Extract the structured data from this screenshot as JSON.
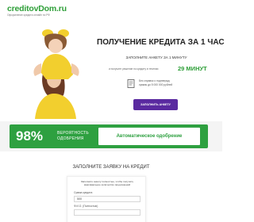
{
  "header": {
    "logo": "creditovDom.ru",
    "tagline": "Оформление кредита онлайн по РФ"
  },
  "hero": {
    "title": "ПОЛУЧЕНИЕ КРЕДИТА ЗА 1 ЧАС",
    "form_label": "ЗАПОЛНИТЕ АНКЕТУ ЗА 1 МИНУТУ",
    "decision_text": "и получите решение по кредиту в течении",
    "decision_time": "29 МИНУТ",
    "docs_line1": "Без справок о подтвержд",
    "docs_line2": "суммы до 5 000 000 рублей",
    "cta_label": "ЗАПОЛНИТЬ АНКЕТУ"
  },
  "approval": {
    "percent": "98%",
    "label_line1": "ВЕРОЯТНОСТЬ",
    "label_line2": "ОДОБРЕНИЯ",
    "auto_text": "Автоматическое одобрение"
  },
  "application": {
    "title": "ЗАПОЛНИТЕ ЗАЯВКУ НА КРЕДИТ",
    "intro_line1": "Заполните анкету полностью, чтобы получить",
    "intro_line2": "максимальное количество предложений",
    "amount_label": "Сумма кредита",
    "amount_value": "500",
    "fullname_label": "Ф.И.О. (Полностью)"
  },
  "colors": {
    "brand_green": "#2ea040",
    "cta_purple": "#5a2aa0",
    "model_dress": "#f2cf2e"
  }
}
